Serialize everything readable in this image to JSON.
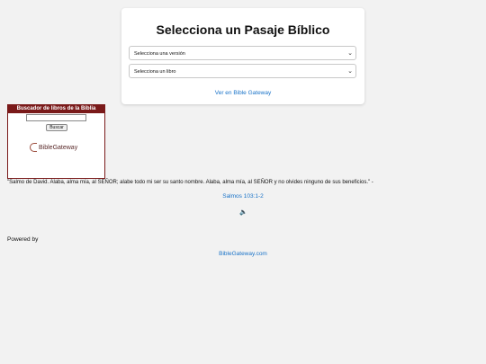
{
  "card": {
    "title": "Selecciona un Pasaje Bíblico",
    "version_select": "Selecciona una versión",
    "book_select": "Selecciona un libro",
    "gateway_link": "Ver en Bible Gateway"
  },
  "widget": {
    "header": "Buscador de libros de la Biblia",
    "search_value": "",
    "search_button": "Buscar",
    "logo_text": "BibleGateway"
  },
  "verse": {
    "text": "\"Salmo de David. Alaba, alma mía, al SEÑOR; alabe todo mi ser su santo nombre. Alaba, alma mía, al SEÑOR y no olvides ninguno de sus beneficios.\" -",
    "reference": "Salmos 103:1-2",
    "audio_icon": "speaker-icon"
  },
  "footer": {
    "powered_by": "Powered by",
    "site_link": "BibleGateway.com"
  },
  "colors": {
    "accent": "#7a1a1a",
    "link": "#1a73c8",
    "background": "#f2f2f2"
  }
}
